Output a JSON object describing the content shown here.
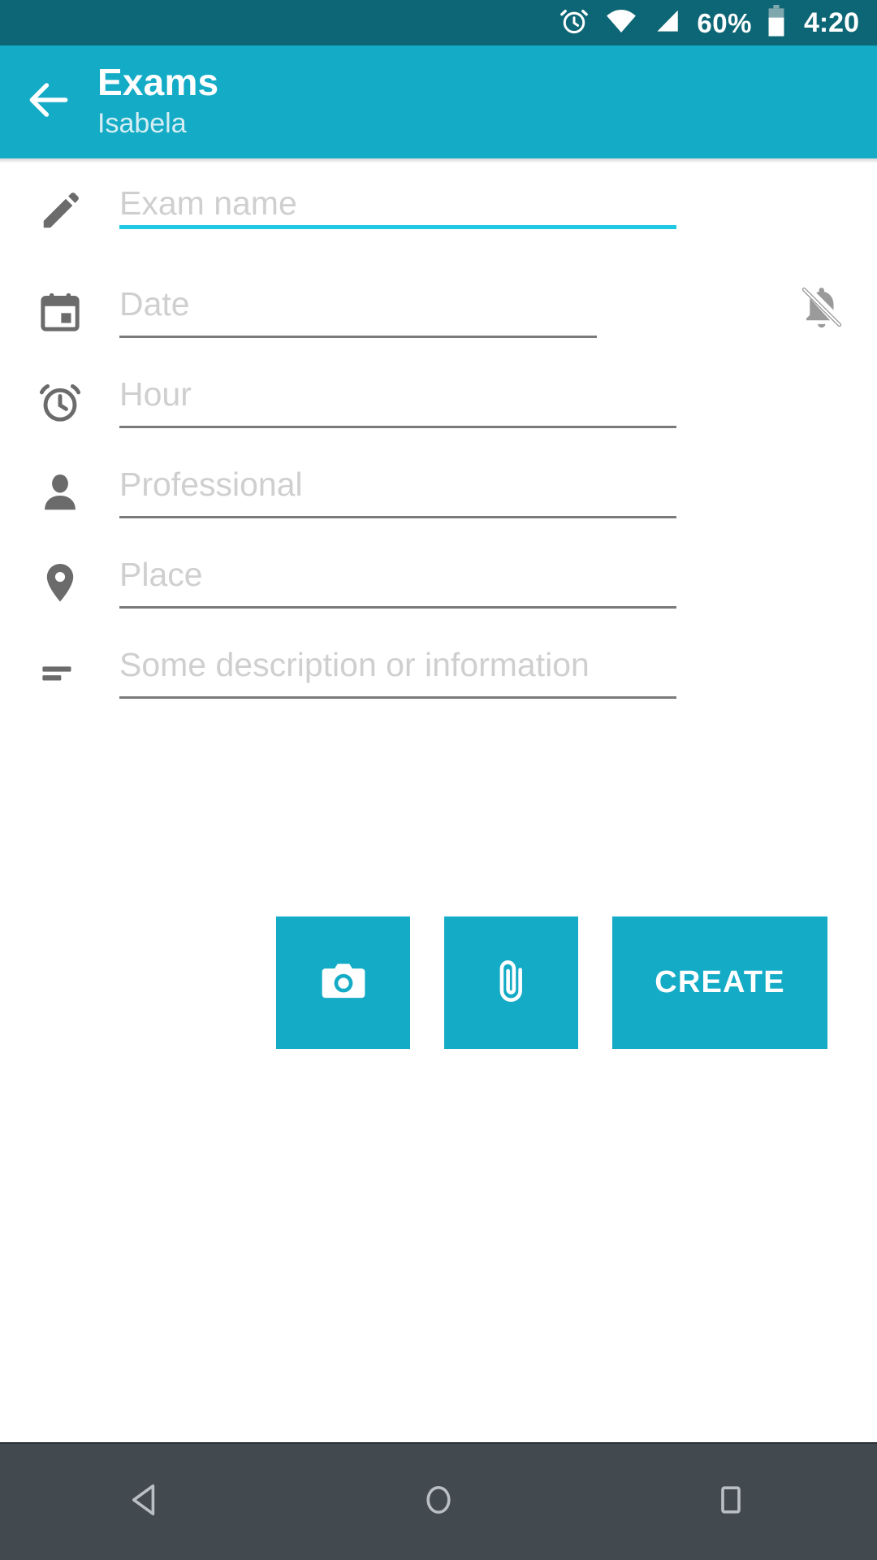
{
  "status_bar": {
    "background_color": "#0d6675",
    "alarm_icon": "alarm-icon",
    "wifi_icon": "wifi-icon",
    "signal_icon": "cell-signal-icon",
    "battery_percent": "60%",
    "battery_icon": "battery-icon",
    "time": "4:20"
  },
  "app_bar": {
    "background_color": "#14abc6",
    "back_icon": "back-arrow-icon",
    "title": "Exams",
    "subtitle": "Isabela"
  },
  "form": {
    "fields": [
      {
        "name": "exam-name",
        "icon": "pencil-icon",
        "placeholder": "Exam name",
        "value": "",
        "focused": true,
        "underline_color": "#1fc8e3",
        "has_trailing": false
      },
      {
        "name": "date",
        "icon": "calendar-icon",
        "placeholder": "Date",
        "value": "",
        "focused": false,
        "underline_color": "#7a7a7a",
        "has_trailing": true,
        "trailing_icon": "notifications-off-icon"
      },
      {
        "name": "hour",
        "icon": "alarm-clock-icon",
        "placeholder": "Hour",
        "value": "",
        "focused": false,
        "underline_color": "#7a7a7a",
        "has_trailing": false
      },
      {
        "name": "professional",
        "icon": "person-icon",
        "placeholder": "Professional",
        "value": "",
        "focused": false,
        "underline_color": "#7a7a7a",
        "has_trailing": false
      },
      {
        "name": "place",
        "icon": "location-pin-icon",
        "placeholder": "Place",
        "value": "",
        "focused": false,
        "underline_color": "#7a7a7a",
        "has_trailing": false
      },
      {
        "name": "description",
        "icon": "notes-icon",
        "placeholder": "Some description or information",
        "value": "",
        "focused": false,
        "underline_color": "#7a7a7a",
        "has_trailing": false
      }
    ]
  },
  "actions": {
    "accent_color": "#14abc6",
    "camera_icon": "camera-icon",
    "attach_icon": "paperclip-icon",
    "create_label": "CREATE"
  },
  "nav_bar": {
    "background_color": "#424a4f",
    "back_icon": "nav-back-triangle-icon",
    "home_icon": "nav-home-circle-icon",
    "recents_icon": "nav-recents-square-icon"
  }
}
